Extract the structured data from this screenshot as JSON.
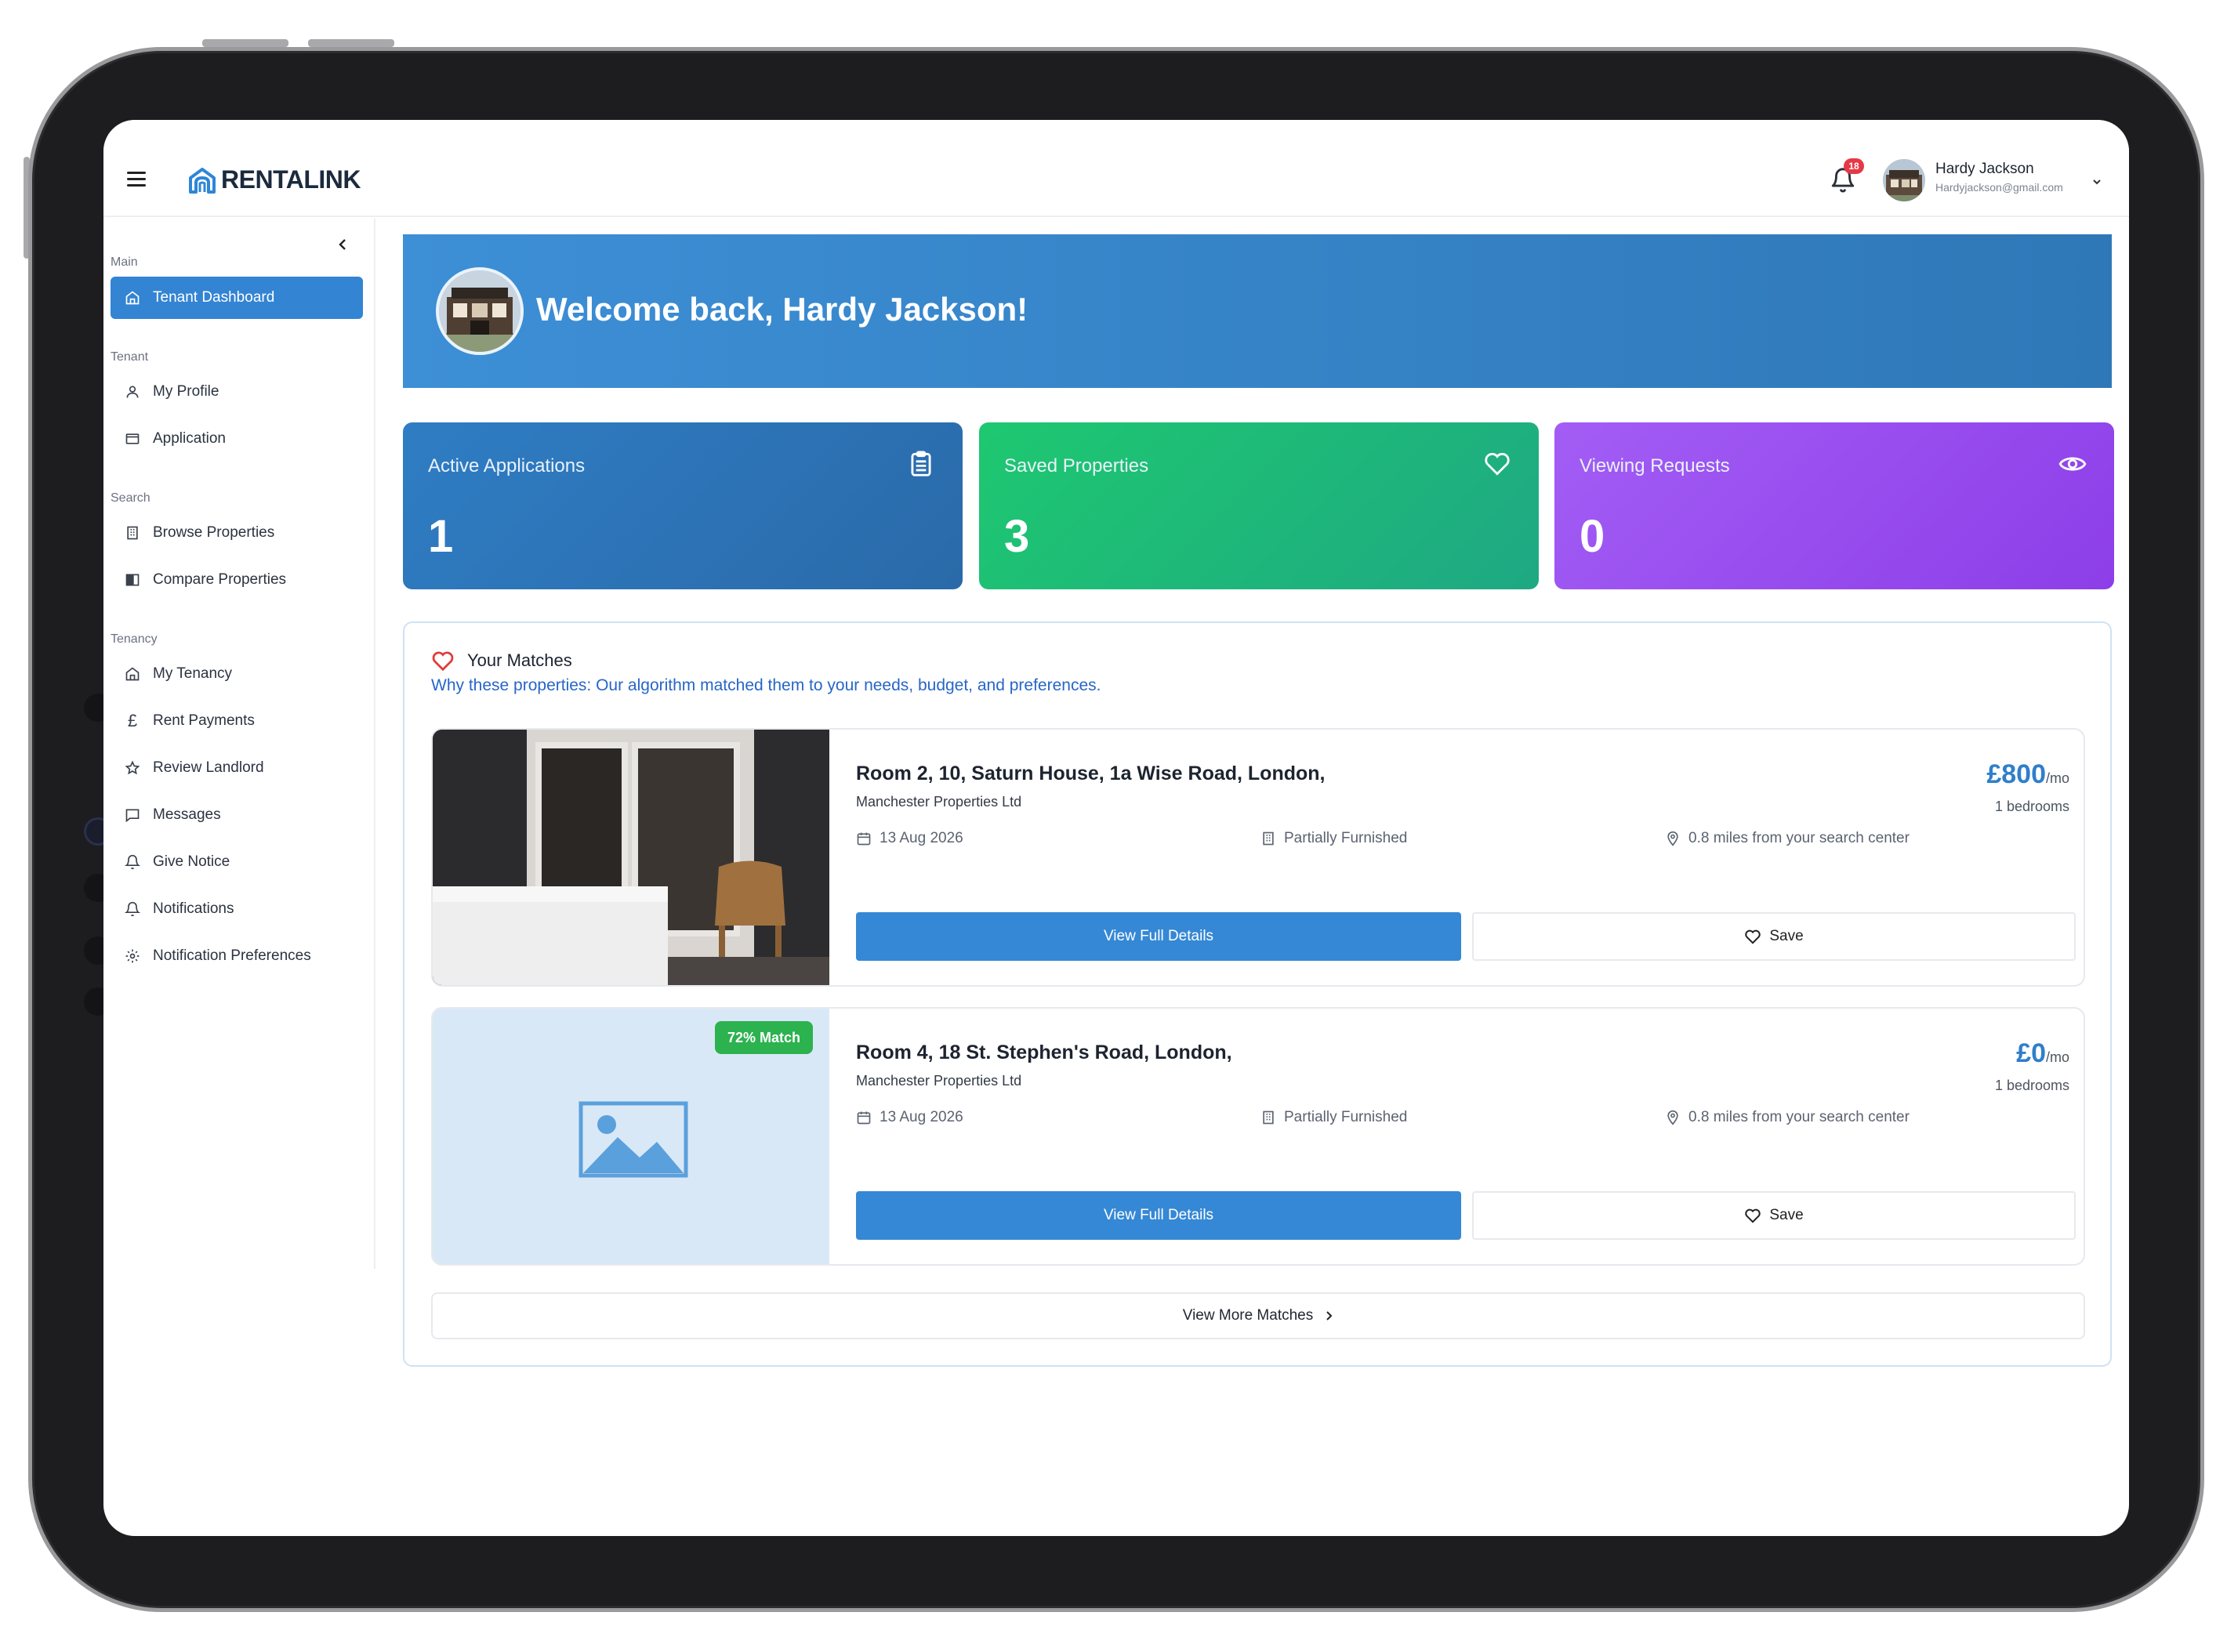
{
  "app": {
    "brand": "RENTALINK"
  },
  "header": {
    "notification_count": "18",
    "user_name": "Hardy Jackson",
    "user_email": "Hardyjackson@gmail.com"
  },
  "sidebar": {
    "sections": {
      "main": "Main",
      "tenant": "Tenant",
      "search": "Search",
      "tenancy": "Tenancy"
    },
    "items": {
      "tenant_dashboard": "Tenant Dashboard",
      "my_profile": "My Profile",
      "application": "Application",
      "browse_properties": "Browse Properties",
      "compare_properties": "Compare Properties",
      "my_tenancy": "My Tenancy",
      "rent_payments": "Rent Payments",
      "review_landlord": "Review Landlord",
      "messages": "Messages",
      "give_notice": "Give Notice",
      "notifications": "Notifications",
      "notification_preferences": "Notification Preferences"
    }
  },
  "banner": {
    "welcome": "Welcome back, Hardy Jackson!"
  },
  "stats": [
    {
      "label": "Active Applications",
      "value": "1",
      "icon": "clipboard-icon",
      "color": "#2f78bd"
    },
    {
      "label": "Saved Properties",
      "value": "3",
      "icon": "heart-icon",
      "color": "#22c36b"
    },
    {
      "label": "Viewing Requests",
      "value": "0",
      "icon": "eye-icon",
      "color": "#9a4df1"
    }
  ],
  "matches": {
    "title": "Your Matches",
    "subtitle": "Why these properties: Our algorithm matched them to your needs, budget, and preferences.",
    "view_more": "View More Matches",
    "properties": [
      {
        "title": "Room 2, 10, Saturn House, 1a Wise Road, London,",
        "company": "Manchester Properties Ltd",
        "date": "13 Aug 2026",
        "furnishing": "Partially Furnished",
        "distance": "0.8 miles from your search center",
        "price": "£800",
        "price_unit": "/mo",
        "bedrooms": "1 bedrooms",
        "details_label": "View Full Details",
        "save_label": "Save"
      },
      {
        "title": "Room 4, 18 St. Stephen's Road, London,",
        "company": "Manchester Properties Ltd",
        "date": "13 Aug 2026",
        "furnishing": "Partially Furnished",
        "distance": "0.8 miles from your search center",
        "price": "£0",
        "price_unit": "/mo",
        "bedrooms": "1 bedrooms",
        "match": "72% Match",
        "details_label": "View Full Details",
        "save_label": "Save"
      }
    ]
  }
}
